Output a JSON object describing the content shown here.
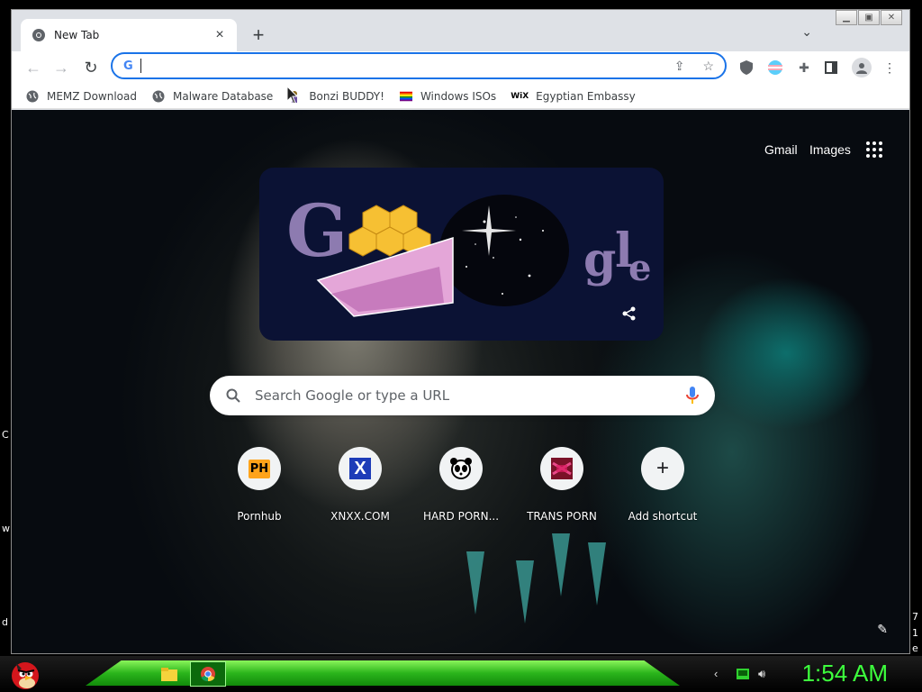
{
  "desktop": {
    "edge_left": [
      "C",
      "w",
      "d"
    ],
    "edge_right": [
      "7",
      "1",
      "e"
    ]
  },
  "window": {
    "tab": {
      "title": "New Tab"
    },
    "toolbar": {
      "omnibox_value": ""
    },
    "bookmarks": [
      {
        "label": "MEMZ Download",
        "icon": "globe-icon"
      },
      {
        "label": "Malware Database",
        "icon": "globe-icon"
      },
      {
        "label": "Bonzi BUDDY!",
        "icon": "bonzi-icon"
      },
      {
        "label": "Windows ISOs",
        "icon": "rainbow-flag-icon"
      },
      {
        "label": "Egyptian Embassy",
        "icon": "wix-icon",
        "icon_text": "WiX"
      }
    ]
  },
  "ntp": {
    "top_links": {
      "gmail": "Gmail",
      "images": "Images"
    },
    "search_placeholder": "Search Google or type a URL",
    "shortcuts": [
      {
        "label": "Pornhub",
        "icon": "ph-icon",
        "icon_text": "PH"
      },
      {
        "label": "XNXX.COM",
        "icon": "x-icon",
        "icon_text": "X"
      },
      {
        "label": "HARD PORN...",
        "icon": "panda-icon"
      },
      {
        "label": "TRANS PORN",
        "icon": "tile-icon"
      },
      {
        "label": "Add shortcut",
        "icon": "plus-icon",
        "icon_text": "+"
      }
    ]
  },
  "taskbar": {
    "clock": "1:54 AM"
  },
  "colors": {
    "accent": "#1a73e8",
    "clock": "#3dff3d",
    "taskbar_green": "#2bb51c"
  }
}
